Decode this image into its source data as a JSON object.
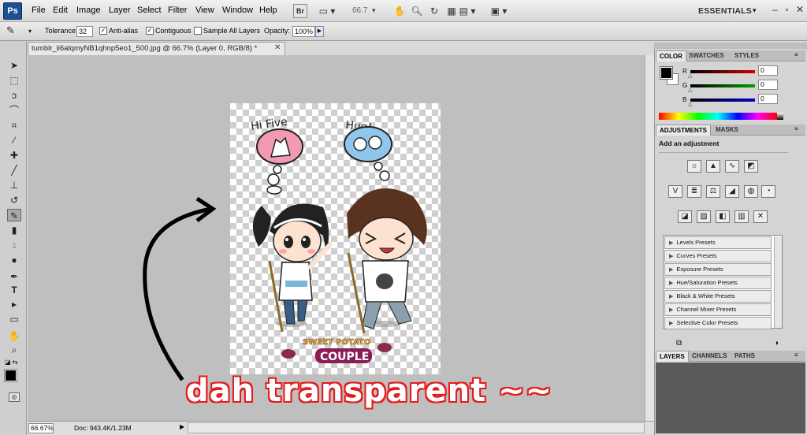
{
  "menubar": {
    "logo": "Ps",
    "menus": [
      "File",
      "Edit",
      "Image",
      "Layer",
      "Select",
      "Filter",
      "View",
      "Window",
      "Help"
    ],
    "zoom_display": "66.7",
    "workspace": "ESSENTIALS"
  },
  "options": {
    "tolerance_label": "Tolerance:",
    "tolerance_value": "32",
    "antialias_label": "Anti-alias",
    "contiguous_label": "Contiguous",
    "sample_all_label": "Sample All Layers",
    "opacity_label": "Opacity:",
    "opacity_value": "100%"
  },
  "document": {
    "tab_title": "tumblr_li6alqmyNB1qhnp5eo1_500.jpg @ 66.7% (Layer 0, RGB/8) *",
    "annotation_text": "dah transparent ~~"
  },
  "status": {
    "zoom": "66.67%",
    "doc_info": "Doc: 943.4K/1.23M"
  },
  "color_panel": {
    "tabs": [
      "COLOR",
      "SWATCHES",
      "STYLES"
    ],
    "channels": [
      {
        "label": "R",
        "value": "0",
        "color": "#d10000"
      },
      {
        "label": "G",
        "value": "0",
        "color": "#00a000"
      },
      {
        "label": "B",
        "value": "0",
        "color": "#0000c8"
      }
    ]
  },
  "adjustments_panel": {
    "tabs": [
      "ADJUSTMENTS",
      "MASKS"
    ],
    "heading": "Add an adjustment",
    "presets": [
      "Levels Presets",
      "Curves Presets",
      "Exposure Presets",
      "Hue/Saturation Presets",
      "Black & White Presets",
      "Channel Mixer Presets",
      "Selective Color Presets"
    ]
  },
  "layers_panel": {
    "tabs": [
      "LAYERS",
      "CHANNELS",
      "PATHS"
    ]
  }
}
